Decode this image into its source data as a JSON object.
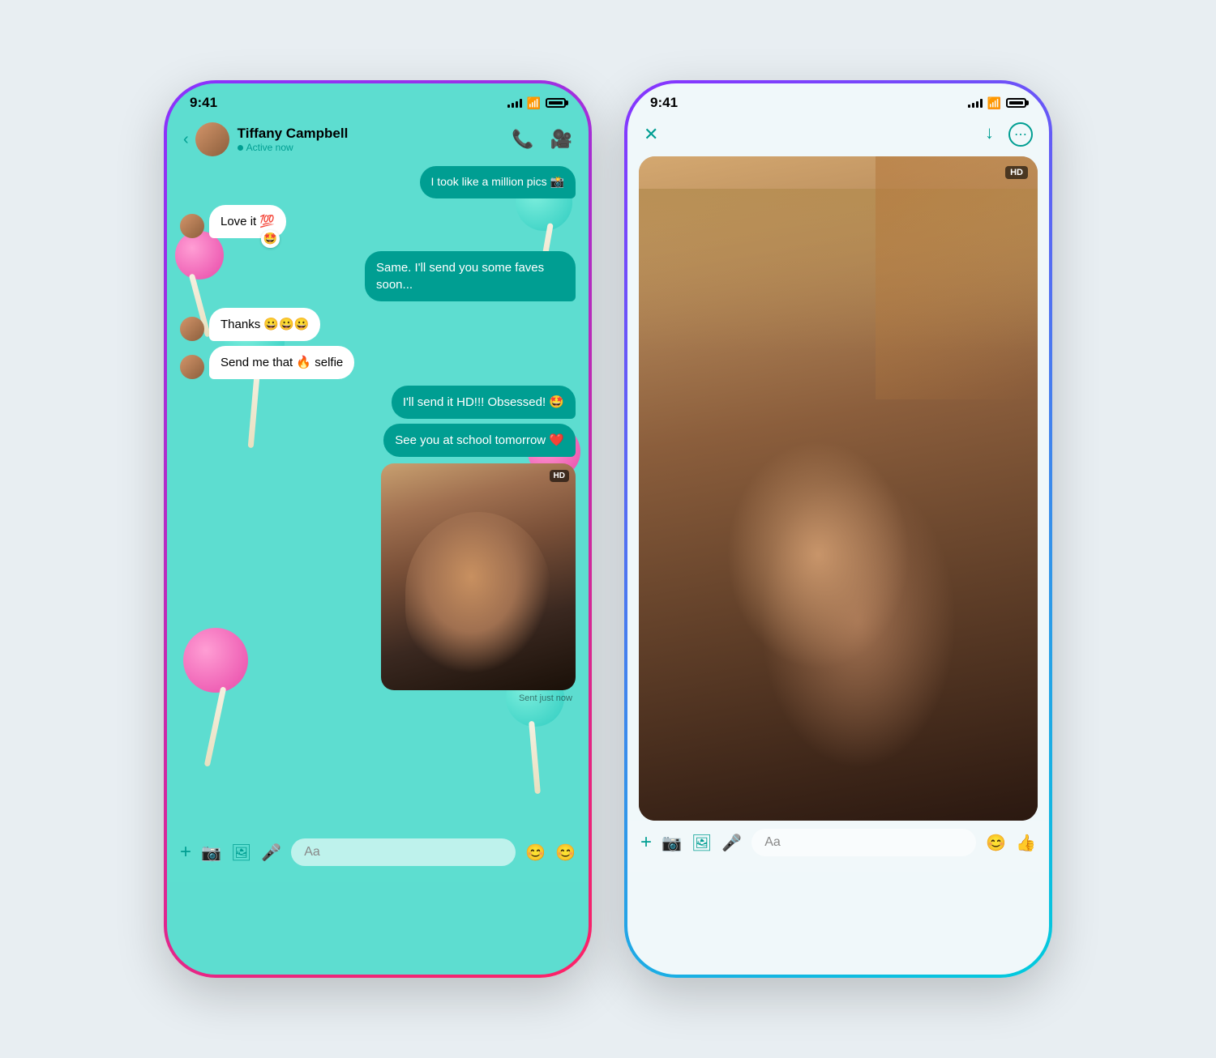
{
  "leftPhone": {
    "statusBar": {
      "time": "9:41",
      "signalBars": [
        3,
        5,
        7,
        9,
        11
      ],
      "wifi": "wifi",
      "battery": "full"
    },
    "header": {
      "backLabel": "‹",
      "contactName": "Tiffany Campbell",
      "contactStatus": "Active now",
      "callIcon": "📞",
      "videoIcon": "📹"
    },
    "messages": [
      {
        "id": 1,
        "type": "outgoing",
        "text": "I took like a million pics 📸",
        "hasReaction": false
      },
      {
        "id": 2,
        "type": "incoming",
        "text": "Love it 💯",
        "hasReaction": "🤩"
      },
      {
        "id": 3,
        "type": "outgoing",
        "text": "Same. I'll send you some faves soon...",
        "hasReaction": false
      },
      {
        "id": 4,
        "type": "incoming",
        "text": "Thanks 😀😀😀",
        "hasReaction": false
      },
      {
        "id": 5,
        "type": "incoming",
        "text": "Send me that 🔥 selfie",
        "hasReaction": false
      },
      {
        "id": 6,
        "type": "outgoing",
        "text": "I'll send it HD!!! Obsessed! 🤩",
        "hasReaction": false
      },
      {
        "id": 7,
        "type": "outgoing",
        "text": "See you at school tomorrow ❤️",
        "hasReaction": false
      },
      {
        "id": 8,
        "type": "photo",
        "sentTime": "Sent just now",
        "hdBadge": "HD"
      }
    ],
    "inputBar": {
      "plusLabel": "+",
      "cameraLabel": "📷",
      "galleryLabel": "🖼",
      "micLabel": "🎤",
      "placeholder": "Aa",
      "emojiLabel": "😊",
      "thumbsLabel": "😊"
    }
  },
  "rightPhone": {
    "statusBar": {
      "time": "9:41"
    },
    "header": {
      "closeLabel": "✕",
      "downloadLabel": "⬇",
      "moreLabel": "···"
    },
    "photo": {
      "hdBadge": "HD"
    },
    "inputBar": {
      "plusLabel": "+",
      "cameraLabel": "📷",
      "galleryLabel": "🖼",
      "micLabel": "🎤",
      "placeholder": "Aa",
      "emojiLabel": "😊",
      "thumbsLabel": "👍"
    }
  },
  "colors": {
    "teal": "#009e92",
    "chatBg": "#5dddd0",
    "rightBg": "#f0f8fa",
    "outgoingBubble": "#009e92",
    "incomingBubble": "#ffffff"
  }
}
